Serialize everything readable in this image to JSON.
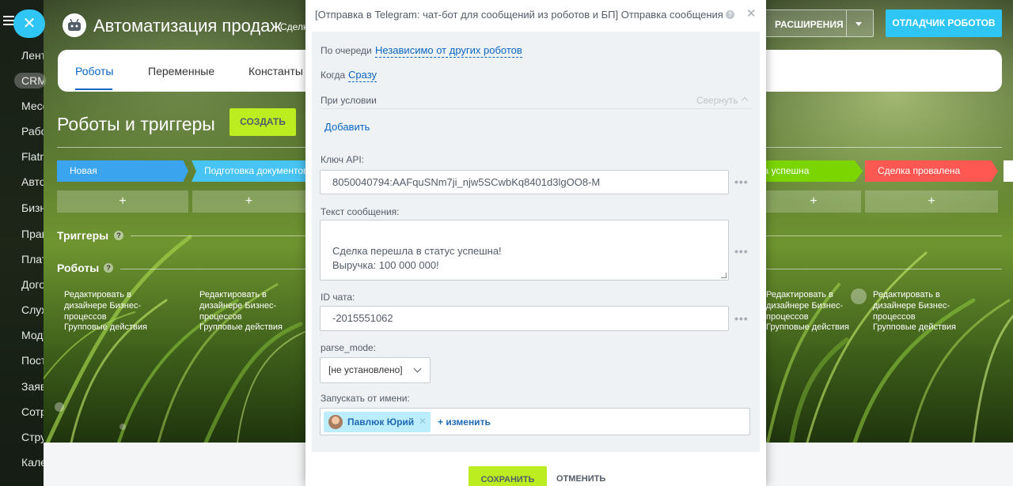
{
  "header": {
    "app_title": "Автоматизация продаж",
    "app_subtitle": "Сделки",
    "extensions_label": "РАСШИРЕНИЯ",
    "debugger_label": "ОТЛАДЧИК РОБОТОВ"
  },
  "sidebar": {
    "items": [
      "Лента",
      "CRM",
      "Мессенджер",
      "Работа",
      "Flatn",
      "Автоматизация",
      "Бизнес",
      "Права",
      "Платежи",
      "Договоры",
      "Службы",
      "Модули",
      "Поставщики",
      "Заявки",
      "Сотрудники",
      "Структура",
      "Календарь"
    ]
  },
  "tabs": [
    {
      "label": "Роботы",
      "active": true
    },
    {
      "label": "Переменные",
      "active": false
    },
    {
      "label": "Константы",
      "active": false
    }
  ],
  "main": {
    "page_title": "Роботы и триггеры",
    "create_label": "СОЗДАТЬ",
    "stages": {
      "new": "Новая",
      "prep": "Подготовка документов",
      "success": "Сделка успешна",
      "fail": "Сделка провалена"
    },
    "stage_colors": {
      "new": "#3aa4ee",
      "prep": "#47c4f4",
      "success": "#7bd500",
      "fail": "#ff5752"
    },
    "add_symbol": "+",
    "triggers_label": "Триггеры",
    "robots_label": "Роботы",
    "edit_in_designer": "Редактировать в дизайнере Бизнес-процессов",
    "group_actions": "Групповые действия"
  },
  "modal": {
    "title": "[Отправка в Telegram: чат-бот для сообщений из роботов и БП] Отправка сообщения",
    "queue_label": "По очереди",
    "queue_value": "Независимо от других роботов",
    "when_label": "Когда",
    "when_value": "Сразу",
    "condition_label": "При условии",
    "collapse_label": "Свернуть",
    "add_label": "Добавить",
    "api_key_label": "Ключ API:",
    "api_key_value": "8050040794:AAFquSNm7ji_njw5SCwbKq8401d3lgOO8-M",
    "message_label": "Текст сообщения:",
    "message_value": "Сделка перешла в статус успешна!\nВыручка: 100 000 000!",
    "chat_id_label": "ID чата:",
    "chat_id_value": "-2015551062",
    "parse_mode_label": "parse_mode:",
    "parse_mode_value": "[не установлено]",
    "run_as_label": "Запускать от имени:",
    "user_name": "Павлюк Юрий",
    "change_label": "изменить",
    "save_label": "СОХРАНИТЬ",
    "cancel_label": "ОТМЕНИТЬ",
    "dots": "•••"
  }
}
